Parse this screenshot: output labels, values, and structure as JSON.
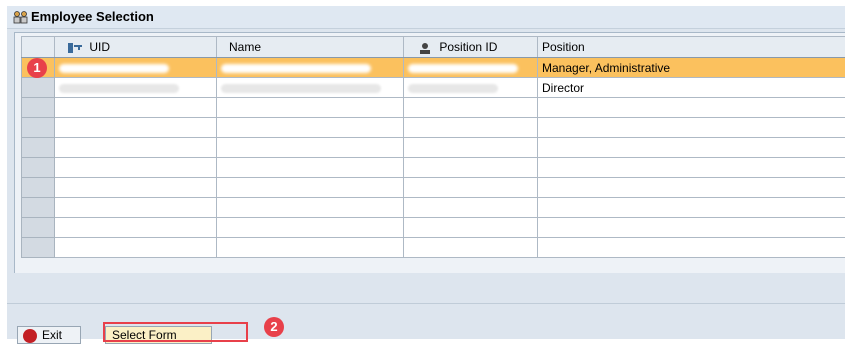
{
  "window": {
    "title": "Employee Selection",
    "title_icon": "employees-group-icon"
  },
  "grid": {
    "columns": [
      {
        "label": "UID",
        "icon": "key-icon"
      },
      {
        "label": "Name",
        "icon": ""
      },
      {
        "label": "Position ID",
        "icon": "person-icon"
      },
      {
        "label": "Position",
        "icon": ""
      }
    ],
    "rows": [
      {
        "uid": "",
        "name": "",
        "position_id": "",
        "position": "Manager, Administrative",
        "selected": true
      },
      {
        "uid": "",
        "name": "",
        "position_id": "",
        "position": "Director",
        "selected": false
      },
      {
        "uid": "",
        "name": "",
        "position_id": "",
        "position": ""
      },
      {
        "uid": "",
        "name": "",
        "position_id": "",
        "position": ""
      },
      {
        "uid": "",
        "name": "",
        "position_id": "",
        "position": ""
      },
      {
        "uid": "",
        "name": "",
        "position_id": "",
        "position": ""
      },
      {
        "uid": "",
        "name": "",
        "position_id": "",
        "position": ""
      },
      {
        "uid": "",
        "name": "",
        "position_id": "",
        "position": ""
      },
      {
        "uid": "",
        "name": "",
        "position_id": "",
        "position": ""
      },
      {
        "uid": "",
        "name": "",
        "position_id": "",
        "position": ""
      }
    ],
    "highlight_color": "#fbc15e"
  },
  "annotations": {
    "marker_1": "1",
    "marker_2": "2",
    "marker_color": "#e8404a"
  },
  "toolbar": {
    "exit_label": "Exit",
    "select_form_label": "Select Form"
  }
}
